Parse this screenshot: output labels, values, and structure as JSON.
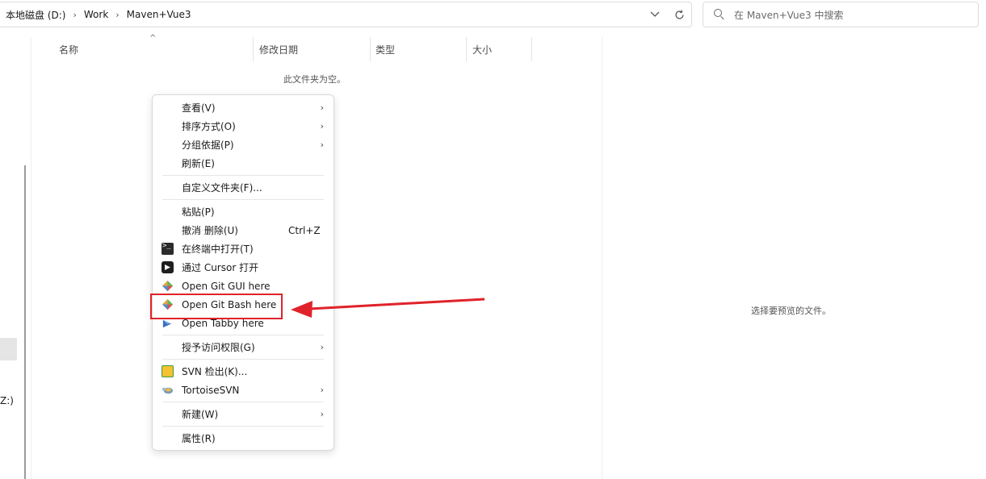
{
  "address_bar": {
    "crumbs": [
      "本地磁盘 (D:)",
      "Work",
      "Maven+Vue3"
    ],
    "dropdown_icon": "chevron-down-icon",
    "refresh_icon": "refresh-icon"
  },
  "search": {
    "placeholder": "在 Maven+Vue3 中搜索",
    "icon": "search-icon"
  },
  "nav": {
    "partial_drive_label": "Z:)"
  },
  "columns": [
    "名称",
    "修改日期",
    "类型",
    "大小"
  ],
  "empty_message": "此文件夹为空。",
  "preview_message": "选择要预览的文件。",
  "context_menu": {
    "items": [
      {
        "label": "查看(V)",
        "submenu": true
      },
      {
        "label": "排序方式(O)",
        "submenu": true
      },
      {
        "label": "分组依据(P)",
        "submenu": true
      },
      {
        "label": "刷新(E)"
      },
      {
        "label": "自定义文件夹(F)..."
      },
      {
        "label": "粘贴(P)"
      },
      {
        "label": "撤消 删除(U)",
        "shortcut": "Ctrl+Z"
      },
      {
        "label": "在终端中打开(T)",
        "icon": "terminal-icon"
      },
      {
        "label": "通过 Cursor 打开",
        "icon": "cursor-app-icon"
      },
      {
        "label": "Open Git GUI here",
        "icon": "git-icon"
      },
      {
        "label": "Open Git Bash here",
        "icon": "git-icon"
      },
      {
        "label": "Open Tabby here",
        "icon": "tabby-icon"
      },
      {
        "label": "授予访问权限(G)",
        "submenu": true
      },
      {
        "label": "SVN 检出(K)...",
        "icon": "svn-checkout-icon"
      },
      {
        "label": "TortoiseSVN",
        "icon": "tortoisesvn-icon",
        "submenu": true
      },
      {
        "label": "新建(W)",
        "submenu": true
      },
      {
        "label": "属性(R)"
      }
    ],
    "arrow_glyph": "›"
  },
  "annotation": {
    "highlighted_item": "Open Git Bash here",
    "color": "#e0222a"
  }
}
